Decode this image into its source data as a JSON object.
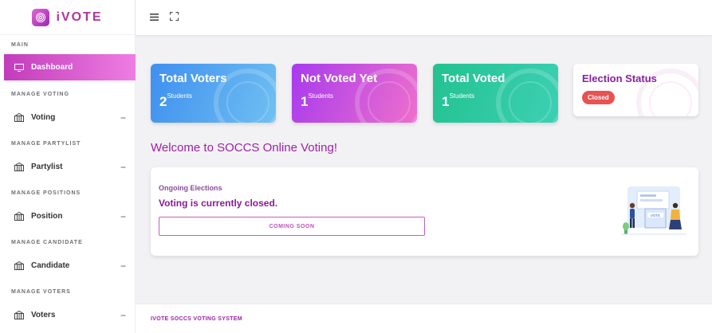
{
  "brand": {
    "name": "iVOTE"
  },
  "sidebar": {
    "sections": [
      {
        "heading": "MAIN",
        "items": [
          {
            "label": "Dashboard",
            "icon": "monitor-icon",
            "active": true
          }
        ]
      },
      {
        "heading": "MANAGE VOTING",
        "items": [
          {
            "label": "Voting",
            "icon": "ballot-box-icon"
          }
        ]
      },
      {
        "heading": "MANAGE PARTYLIST",
        "items": [
          {
            "label": "Partylist",
            "icon": "ballot-box-icon"
          }
        ]
      },
      {
        "heading": "MANAGE POSITIONS",
        "items": [
          {
            "label": "Position",
            "icon": "ballot-box-icon"
          }
        ]
      },
      {
        "heading": "MANAGE CANDIDATE",
        "items": [
          {
            "label": "Candidate",
            "icon": "ballot-box-icon"
          }
        ]
      },
      {
        "heading": "MANAGE VOTERS",
        "items": [
          {
            "label": "Voters",
            "icon": "ballot-box-icon"
          }
        ]
      }
    ],
    "collapse_symbol": "−"
  },
  "topbar": {
    "menu_icon": "hamburger-icon",
    "fullscreen_icon": "fullscreen-icon"
  },
  "cards": [
    {
      "title": "Total Voters",
      "value": "2",
      "unit": "Students",
      "color": "#3f8ff0"
    },
    {
      "title": "Not Voted Yet",
      "value": "1",
      "unit": "Students",
      "color": "#a83bee"
    },
    {
      "title": "Total Voted",
      "value": "1",
      "unit": "Students",
      "color": "#23c291"
    },
    {
      "title": "Election Status",
      "status": "Closed",
      "status_color": "#e85252"
    }
  ],
  "welcome": "Welcome to SOCCS Online Voting!",
  "panel": {
    "subtitle": "Ongoing Elections",
    "title": "Voting is currently closed.",
    "button": "COMING SOON"
  },
  "footer": "IVOTE SOCCS VOTING SYSTEM"
}
